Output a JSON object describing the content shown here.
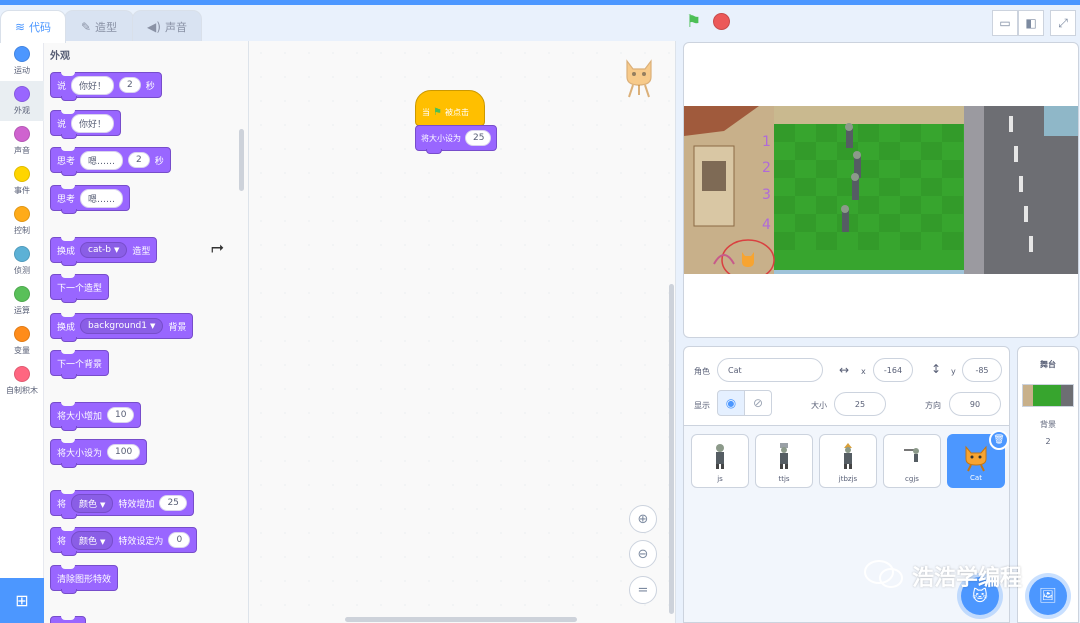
{
  "tabs": {
    "code": "代码",
    "costumes": "造型",
    "sounds": "声音"
  },
  "categories": [
    {
      "label": "运动",
      "color": "#4c97ff"
    },
    {
      "label": "外观",
      "color": "#9966ff"
    },
    {
      "label": "声音",
      "color": "#cf63cf"
    },
    {
      "label": "事件",
      "color": "#ffd500"
    },
    {
      "label": "控制",
      "color": "#ffab19"
    },
    {
      "label": "侦测",
      "color": "#5cb1d6"
    },
    {
      "label": "运算",
      "color": "#59c059"
    },
    {
      "label": "变量",
      "color": "#ff8c1a"
    },
    {
      "label": "自制积木",
      "color": "#ff6680"
    }
  ],
  "palette": {
    "title": "外观",
    "blocks": {
      "say_secs": {
        "a": "说",
        "msg": "你好！",
        "secs": "2",
        "b": "秒"
      },
      "say": {
        "a": "说",
        "msg": "你好！"
      },
      "think_secs": {
        "a": "思考",
        "msg": "嗯……",
        "secs": "2",
        "b": "秒"
      },
      "think": {
        "a": "思考",
        "msg": "嗯……"
      },
      "switch_costume": {
        "a": "换成",
        "costume": "cat-b",
        "b": "造型"
      },
      "next_costume": "下一个造型",
      "switch_backdrop": {
        "a": "换成",
        "backdrop": "background1",
        "b": "背景"
      },
      "next_backdrop": "下一个背景",
      "change_size": {
        "a": "将大小增加",
        "value": "10"
      },
      "set_size": {
        "a": "将大小设为",
        "value": "100"
      },
      "change_effect": {
        "a": "将",
        "effect": "颜色",
        "b": "特效增加",
        "value": "25"
      },
      "set_effect": {
        "a": "将",
        "effect": "颜色",
        "b": "特效设定为",
        "value": "0"
      },
      "clear_effects": "清除图形特效"
    }
  },
  "script": {
    "hat": {
      "a": "当",
      "b": "被点击"
    },
    "set_size": {
      "a": "将大小设为",
      "value": "25"
    }
  },
  "stage_lanes": [
    "1",
    "2",
    "3",
    "4"
  ],
  "sprite_info": {
    "sprite_label": "角色",
    "sprite_name": "Cat",
    "x_label": "x",
    "x_value": "-164",
    "y_label": "y",
    "y_value": "-85",
    "show_label": "显示",
    "size_label": "大小",
    "size_value": "25",
    "direction_label": "方向",
    "direction_value": "90"
  },
  "sprites": [
    "js",
    "ttjs",
    "jtbzjs",
    "cgjs",
    "Cat"
  ],
  "stage_target": {
    "title": "舞台",
    "backdrop_label": "背景",
    "backdrop_count": "2"
  },
  "watermark": "浩浩学编程",
  "colors": {
    "accent": "#4c97ff",
    "looks": "#9966ff",
    "events": "#ffbf00"
  }
}
